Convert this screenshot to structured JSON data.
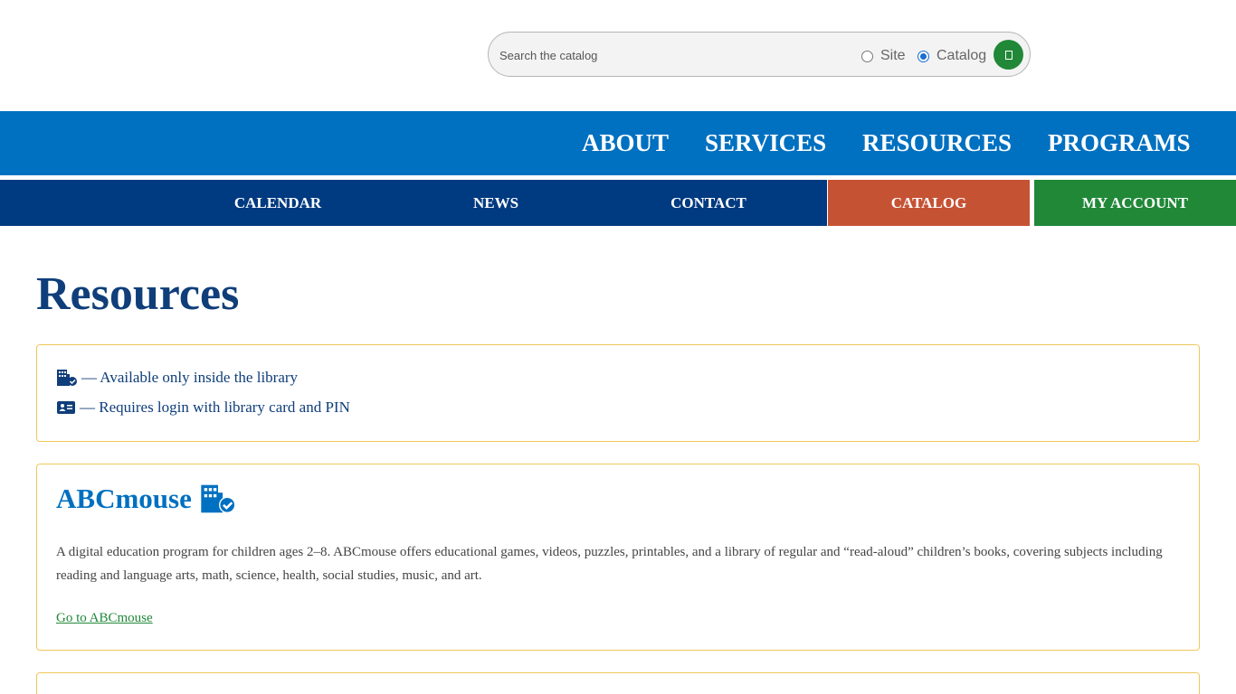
{
  "search": {
    "placeholder": "Search the catalog",
    "scope_options": [
      {
        "label": "Site",
        "selected": false
      },
      {
        "label": "Catalog",
        "selected": true
      }
    ],
    "submit_icon": "search-icon"
  },
  "primary_nav": {
    "items": [
      "ABOUT",
      "SERVICES",
      "RESOURCES",
      "PROGRAMS"
    ]
  },
  "secondary_nav": {
    "items": [
      "CALENDAR",
      "NEWS",
      "CONTACT",
      "CATALOG",
      "MY ACCOUNT"
    ]
  },
  "page": {
    "title": "Resources"
  },
  "legend": {
    "rows": [
      {
        "icon": "building-check-icon",
        "text": "— Available only inside the library"
      },
      {
        "icon": "id-card-icon",
        "text": "— Requires login with library card and PIN"
      }
    ]
  },
  "resources": [
    {
      "title": "ABCmouse",
      "icon": "building-check-icon",
      "description": "A digital education program for children ages 2–8. ABCmouse offers educational games, videos, puzzles, printables, and a library of regular and “read-aloud” children’s books, covering subjects including reading and language arts, math, science, health, social studies, music, and art.",
      "link_text": "Go to ABCmouse"
    }
  ],
  "colors": {
    "primary_blue": "#0070c0",
    "dark_blue": "#003a80",
    "catalog_orange": "#c65234",
    "account_green": "#218838",
    "card_border": "#f0c85a",
    "title_navy": "#0f3e7a"
  }
}
